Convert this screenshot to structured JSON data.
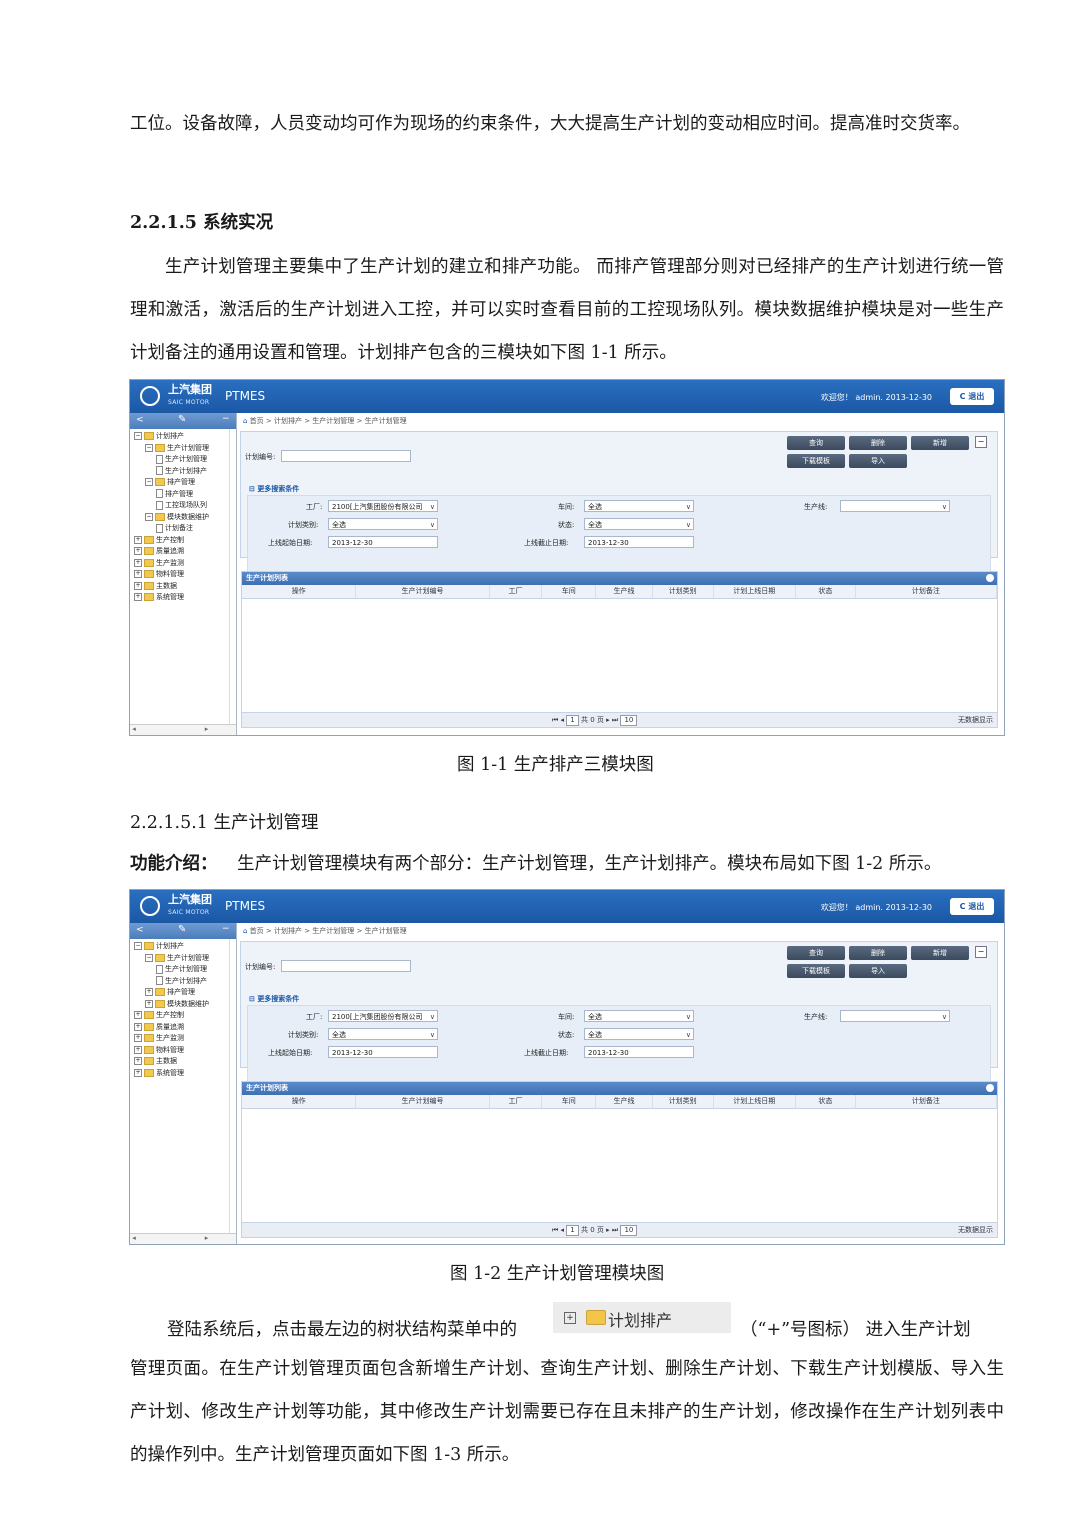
{
  "p1": "工位。设备故障，人员变动均可作为现场的约束条件，大大提高生产计划的变动相应时间。提高准时交货率。",
  "heading_215": "2.2.1.5 系统实况",
  "p2": "生产计划管理主要集中了生产计划的建立和排产功能。 而排产管理部分则对已经排产的生产计划进行统一管理和激活，激活后的生产计划进入工控，并可以实时查看目前的工控现场队列。模块数据维护模块是对一些生产计划备注的通用设置和管理。计划排产包含的三模块如下图 1-1 所示。",
  "caption1": "图 1-1 生产排产三模块图",
  "heading_2151": "2.2.1.5.1 生产计划管理",
  "func_label": "功能介绍：",
  "func_text": "生产计划管理模块有两个部分：生产计划管理，生产计划排产。模块布局如下图 1-2 所示。",
  "caption2": "图 1-2 生产计划管理模块图",
  "p3_before": "登陆系统后，点击最左边的树状结构菜单中的",
  "inline_icon_label": "计划排产",
  "p3_after": "（“+”号图标） 进入生产计划",
  "p3_rest": "管理页面。在生产计划管理页面包含新增生产计划、查询生产计划、删除生产计划、下载生产计划模版、导入生产计划、修改生产计划等功能，其中修改生产计划需要已存在且未排产的生产计划，修改操作在生产计划列表中的操作列中。生产计划管理页面如下图 1-3 所示。",
  "app": {
    "logo_cn": "上汽集团",
    "logo_en": "SAIC MOTOR",
    "name": "PTMES",
    "welcome": "欢迎您！ admin. 2013-12-30",
    "logout": "退出",
    "breadcrumb1": "首页 > 计划排产 > 生产计划管理 > 生产计划管理",
    "breadcrumb2": "首页 > 计划排产 > 生产计划管理 > 生产计划管理",
    "buttons": {
      "query": "查询",
      "delete": "删除",
      "add": "新增",
      "download": "下载模板",
      "import": "导入"
    },
    "plan_no_label": "计划编号:",
    "more_conditions": "更多搜索条件",
    "factory_label": "工厂:",
    "factory_value": "2100[上汽集团股份有限公司",
    "workshop_label": "车间:",
    "workshop_value": "全选",
    "line_label": "生产线:",
    "type_label": "计划类别:",
    "type_value": "全选",
    "status_label": "状态:",
    "status_value": "全选",
    "start_label": "上线起始日期:",
    "start_value": "2013-12-30",
    "end_label": "上线截止日期:",
    "end_value": "2013-12-30",
    "grid_title": "生产计划列表",
    "columns": [
      "操作",
      "生产计划编号",
      "工厂",
      "车间",
      "生产线",
      "计划类别",
      "计划上线日期",
      "状态",
      "计划备注"
    ],
    "pager": {
      "page": "1",
      "total": "共 0 页",
      "size": "10"
    },
    "no_data": "无数据显示",
    "tree1": [
      {
        "label": "计划排产",
        "level": 0,
        "kind": "folder",
        "pm": "−"
      },
      {
        "label": "生产计划管理",
        "level": 1,
        "kind": "folder",
        "pm": "−"
      },
      {
        "label": "生产计划管理",
        "level": 2,
        "kind": "doc"
      },
      {
        "label": "生产计划排产",
        "level": 2,
        "kind": "doc"
      },
      {
        "label": "排产管理",
        "level": 1,
        "kind": "folder",
        "pm": "−"
      },
      {
        "label": "排产管理",
        "level": 2,
        "kind": "doc"
      },
      {
        "label": "工控现场队列",
        "level": 2,
        "kind": "doc"
      },
      {
        "label": "模块数据维护",
        "level": 1,
        "kind": "folder",
        "pm": "−"
      },
      {
        "label": "计划备注",
        "level": 2,
        "kind": "doc"
      },
      {
        "label": "生产控制",
        "level": 0,
        "kind": "folder",
        "pm": "+"
      },
      {
        "label": "质量追溯",
        "level": 0,
        "kind": "folder",
        "pm": "+"
      },
      {
        "label": "生产监测",
        "level": 0,
        "kind": "folder",
        "pm": "+"
      },
      {
        "label": "物料管理",
        "level": 0,
        "kind": "folder",
        "pm": "+"
      },
      {
        "label": "主数据",
        "level": 0,
        "kind": "folder",
        "pm": "+"
      },
      {
        "label": "系统管理",
        "level": 0,
        "kind": "folder",
        "pm": "+"
      }
    ],
    "tree2": [
      {
        "label": "计划排产",
        "level": 0,
        "kind": "folder",
        "pm": "−"
      },
      {
        "label": "生产计划管理",
        "level": 1,
        "kind": "folder",
        "pm": "−"
      },
      {
        "label": "生产计划管理",
        "level": 2,
        "kind": "doc"
      },
      {
        "label": "生产计划排产",
        "level": 2,
        "kind": "doc"
      },
      {
        "label": "排产管理",
        "level": 1,
        "kind": "folder",
        "pm": "+"
      },
      {
        "label": "模块数据维护",
        "level": 1,
        "kind": "folder",
        "pm": "+"
      },
      {
        "label": "生产控制",
        "level": 0,
        "kind": "folder",
        "pm": "+"
      },
      {
        "label": "质量追溯",
        "level": 0,
        "kind": "folder",
        "pm": "+"
      },
      {
        "label": "生产监测",
        "level": 0,
        "kind": "folder",
        "pm": "+"
      },
      {
        "label": "物料管理",
        "level": 0,
        "kind": "folder",
        "pm": "+"
      },
      {
        "label": "主数据",
        "level": 0,
        "kind": "folder",
        "pm": "+"
      },
      {
        "label": "系统管理",
        "level": 0,
        "kind": "folder",
        "pm": "+"
      }
    ]
  }
}
